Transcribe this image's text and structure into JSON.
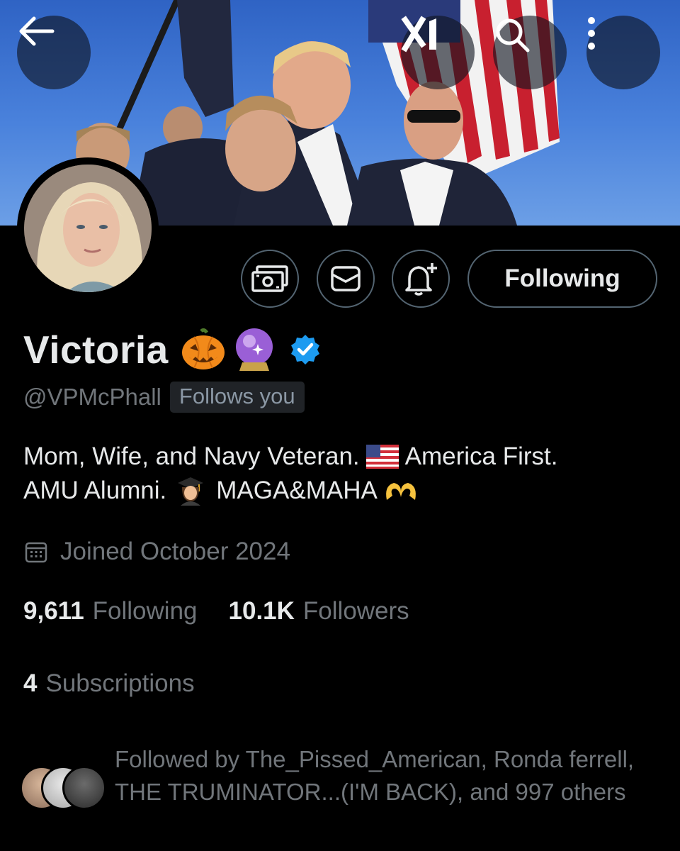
{
  "header": {
    "back_icon": "arrow-left-icon",
    "grok_icon": "grok-logo-icon",
    "search_icon": "search-icon",
    "more_icon": "more-vertical-icon"
  },
  "actions": {
    "subscribe_icon": "money-icon",
    "message_icon": "mail-icon",
    "notify_icon": "bell-plus-icon",
    "following_label": "Following"
  },
  "profile": {
    "name": "Victoria",
    "name_emojis": [
      "🎃",
      "🔮"
    ],
    "verified": true,
    "handle": "@VPMcPhall",
    "follows_you": "Follows you",
    "bio_line1_a": "Mom, Wife, and Navy Veteran.",
    "bio_line1_b": "America First.",
    "bio_line2_a": "AMU Alumni.",
    "bio_line2_b": "MAGA&MAHA",
    "bio_emojis": [
      "🇺🇸",
      "👩‍🎓",
      "🫶"
    ],
    "joined": "Joined October 2024"
  },
  "stats": {
    "following_count": "9,611",
    "following_label": "Following",
    "followers_count": "10.1K",
    "followers_label": "Followers",
    "subscriptions_count": "4",
    "subscriptions_label": "Subscriptions"
  },
  "followed_by": "Followed by The_Pissed_American, Ronda ferrell, THE TRUMINATOR...(I'M BACK), and 997 others",
  "colors": {
    "background": "#000000",
    "text": "#e7e9ea",
    "secondary": "#71767b",
    "border": "#536471",
    "verified_blue": "#1d9bf0"
  }
}
